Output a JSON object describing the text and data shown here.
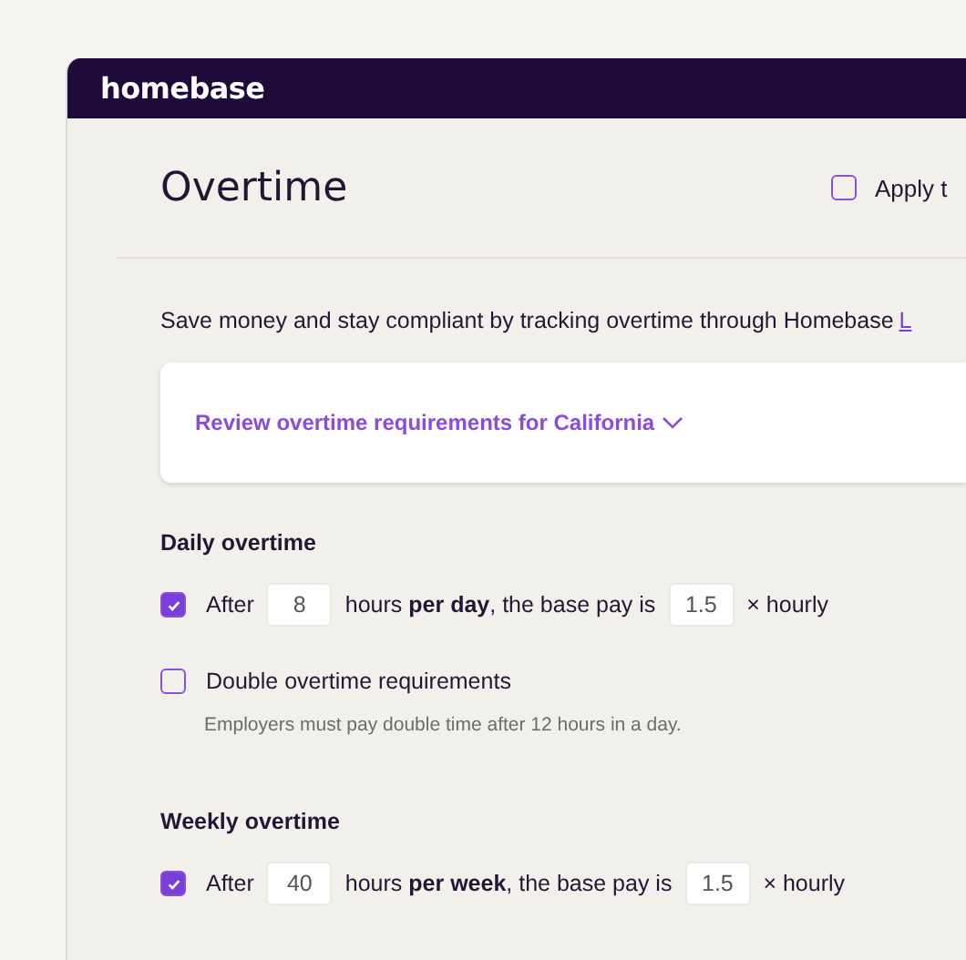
{
  "app": {
    "brand": "homebase"
  },
  "header": {
    "title": "Overtime",
    "apply_all": {
      "label": "Apply t",
      "checked": false
    }
  },
  "intro": {
    "text": "Save money and stay compliant by tracking overtime through Homebase",
    "link": "L"
  },
  "requirements": {
    "label": "Review overtime requirements for California",
    "expanded": false
  },
  "sections": [
    {
      "title": "Daily overtime",
      "items": [
        {
          "kind": "rule",
          "checked": true,
          "before": "After",
          "hours": "8",
          "middle": "hours **per day**, the base pay is",
          "rate": "1.5",
          "after": "× hourly"
        },
        {
          "kind": "option",
          "checked": false,
          "label": "Double overtime requirements",
          "hint": "Employers must pay double time after 12 hours in a day."
        }
      ]
    },
    {
      "title": "Weekly overtime",
      "items": [
        {
          "kind": "rule",
          "checked": true,
          "before": "After",
          "hours": "40",
          "middle": "hours **per week**, the base pay is",
          "rate": "1.5",
          "after": "× hourly"
        }
      ]
    }
  ]
}
